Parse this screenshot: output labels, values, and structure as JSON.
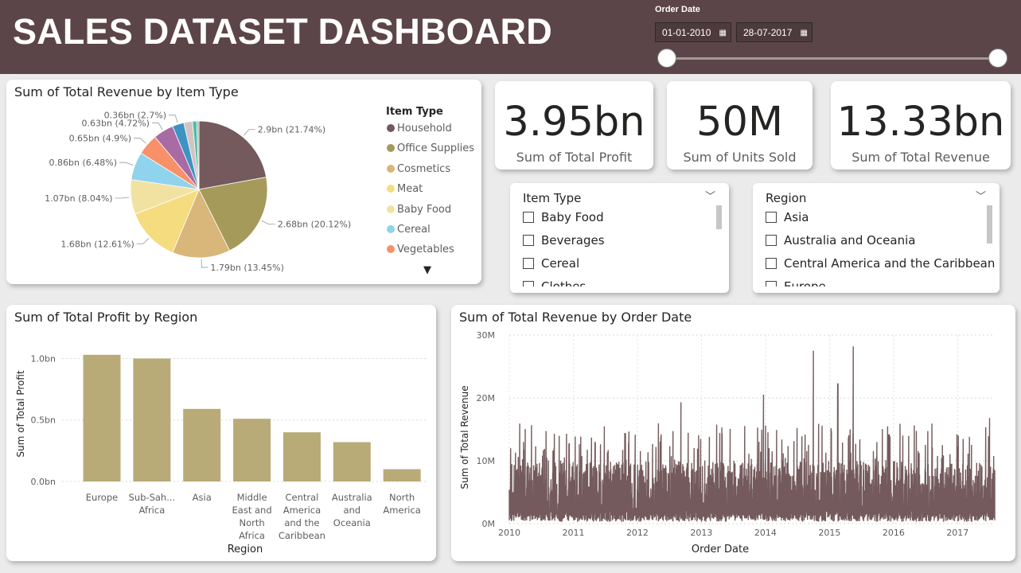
{
  "header": {
    "title": "SALES DATASET DASHBOARD"
  },
  "date_slicer": {
    "label": "Order Date",
    "start": "01-01-2010",
    "end": "28-07-2017",
    "range_fraction": [
      0,
      1
    ]
  },
  "kpis": [
    {
      "value": "3.95bn",
      "caption": "Sum of Total Profit"
    },
    {
      "value": "50M",
      "caption": "Sum of Units Sold"
    },
    {
      "value": "13.33bn",
      "caption": "Sum of Total Revenue"
    }
  ],
  "slicers": {
    "item_type": {
      "title": "Item Type",
      "options": [
        "Baby Food",
        "Beverages",
        "Cereal",
        "Clothes"
      ]
    },
    "region": {
      "title": "Region",
      "options": [
        "Asia",
        "Australia and Oceania",
        "Central America and the Caribbean",
        "Europe"
      ]
    }
  },
  "chart_data": [
    {
      "type": "pie",
      "title": "Sum of Total Revenue by Item Type",
      "legend_title": "Item Type",
      "legend_position": "right",
      "slices": [
        {
          "label": "Household",
          "value_label": "2.9bn (21.74%)",
          "percent": 21.74,
          "color": "#745a5c"
        },
        {
          "label": "Office Supplies",
          "value_label": "2.68bn (20.12%)",
          "percent": 20.12,
          "color": "#a59a5a"
        },
        {
          "label": "Cosmetics",
          "value_label": "1.79bn (13.45%)",
          "percent": 13.45,
          "color": "#d9b679"
        },
        {
          "label": "Meat",
          "value_label": "1.68bn (12.61%)",
          "percent": 12.61,
          "color": "#f4dc7f"
        },
        {
          "label": "Baby Food",
          "value_label": "1.07bn (8.04%)",
          "percent": 8.04,
          "color": "#f2e2a2"
        },
        {
          "label": "Cereal",
          "value_label": "0.86bn (6.48%)",
          "percent": 6.48,
          "color": "#8fd3ec"
        },
        {
          "label": "Vegetables",
          "value_label": "0.65bn (4.9%)",
          "percent": 4.9,
          "color": "#f89169"
        },
        {
          "label": "",
          "value_label": "0.63bn (4.72%)",
          "percent": 4.72,
          "color": "#a96ba3"
        },
        {
          "label": "",
          "value_label": "0.36bn (2.7%)",
          "percent": 2.7,
          "color": "#3d93c2"
        },
        {
          "label": "",
          "value_label": "",
          "percent": 2.0,
          "color": "#d3c3c3"
        },
        {
          "label": "",
          "value_label": "",
          "percent": 1.0,
          "color": "#4dbdab"
        },
        {
          "label": "",
          "value_label": "",
          "percent": 0.5,
          "color": "#b8b2a0"
        }
      ],
      "visible_legend_count": 7
    },
    {
      "type": "bar",
      "title": "Sum of Total Profit by Region",
      "xlabel": "Region",
      "ylabel": "Sum of Total Profit",
      "ylim": [
        0,
        1.1
      ],
      "yticks": [
        {
          "v": 0,
          "label": "0.0bn"
        },
        {
          "v": 0.5,
          "label": "0.5bn"
        },
        {
          "v": 1.0,
          "label": "1.0bn"
        }
      ],
      "grid": true,
      "color": "#b8ab78",
      "categories": [
        [
          "Europe"
        ],
        [
          "Sub-Sah...",
          "Africa"
        ],
        [
          "Asia"
        ],
        [
          "Middle",
          "East and",
          "North",
          "Africa"
        ],
        [
          "Central",
          "America",
          "and the",
          "Caribbean"
        ],
        [
          "Australia",
          "and",
          "Oceania"
        ],
        [
          "North",
          "America"
        ]
      ],
      "values": [
        1.03,
        1.0,
        0.59,
        0.51,
        0.4,
        0.32,
        0.1
      ]
    },
    {
      "type": "line",
      "title": "Sum of Total Revenue by Order Date",
      "xlabel": "Order Date",
      "ylabel": "Sum of Total Revenue",
      "ylim": [
        0,
        30
      ],
      "yticks": [
        {
          "v": 0,
          "label": "0M"
        },
        {
          "v": 10,
          "label": "10M"
        },
        {
          "v": 20,
          "label": "20M"
        },
        {
          "v": 30,
          "label": "30M"
        }
      ],
      "xticks": [
        "2010",
        "2011",
        "2012",
        "2013",
        "2014",
        "2015",
        "2016",
        "2017"
      ],
      "xrange_years": [
        2010,
        2017.58
      ],
      "grid": true,
      "color": "#745a5c",
      "typical_band_M": [
        1,
        10
      ],
      "peaks": [
        {
          "year": 2014.75,
          "value": 27.5
        },
        {
          "year": 2015.37,
          "value": 28.2
        },
        {
          "year": 2015.13,
          "value": 22.3
        },
        {
          "year": 2013.97,
          "value": 20.5
        },
        {
          "year": 2012.68,
          "value": 19.3
        },
        {
          "year": 2017.5,
          "value": 16.8
        }
      ]
    }
  ]
}
